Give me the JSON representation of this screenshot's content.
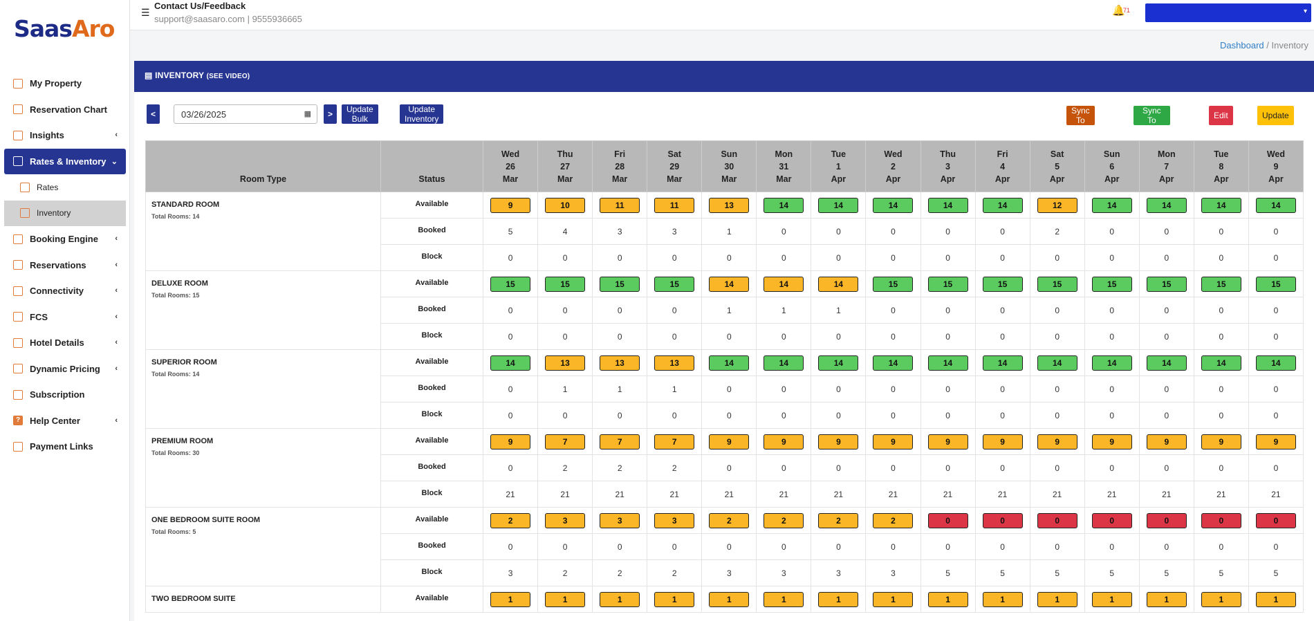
{
  "brand": {
    "part1": "Saas",
    "part2": "Aro"
  },
  "topbar": {
    "contact_title": "Contact Us/Feedback",
    "contact_info": "support@saasaro.com | 9555936665",
    "notification_count": "71"
  },
  "breadcrumb": {
    "home": "Dashboard",
    "separator": "/",
    "current": "Inventory"
  },
  "sidebar": {
    "items": [
      {
        "label": "My Property",
        "icon": "home-icon",
        "chevron": false
      },
      {
        "label": "Reservation Chart",
        "icon": "calendar-icon",
        "chevron": false
      },
      {
        "label": "Insights",
        "icon": "chart-pie-icon",
        "chevron": true
      },
      {
        "label": "Rates & Inventory",
        "icon": "building-icon",
        "chevron": true,
        "active": true
      },
      {
        "label": "Rates",
        "icon": "rates-icon",
        "sub": true
      },
      {
        "label": "Inventory",
        "icon": "inventory-icon",
        "sub": true,
        "selected": true
      },
      {
        "label": "Booking Engine",
        "icon": "booking-engine-icon",
        "chevron": true
      },
      {
        "label": "Reservations",
        "icon": "reservations-icon",
        "chevron": true
      },
      {
        "label": "Connectivity",
        "icon": "connectivity-icon",
        "chevron": true
      },
      {
        "label": "FCS",
        "icon": "id-card-icon",
        "chevron": true
      },
      {
        "label": "Hotel Details",
        "icon": "hotel-icon",
        "chevron": true
      },
      {
        "label": "Dynamic Pricing",
        "icon": "dynamic-pricing-icon",
        "chevron": true
      },
      {
        "label": "Subscription",
        "icon": "dollar-icon",
        "chevron": false
      },
      {
        "label": "Help Center",
        "icon": "help-icon",
        "chevron": true
      },
      {
        "label": "Payment Links",
        "icon": "payment-link-icon",
        "chevron": false
      }
    ]
  },
  "panel": {
    "title": "INVENTORY",
    "see_video": "(SEE VIDEO)"
  },
  "toolbar": {
    "prev_label": "<",
    "next_label": ">",
    "date_value": "03/26/2025",
    "update_bulk": "Update Bulk",
    "update_team": "Update Inventory (Team)",
    "sync_ota": "Sync To OTA",
    "sync_google": "Sync To Google",
    "edit": "Edit",
    "update": "Update"
  },
  "table": {
    "headers": {
      "room_type": "Room Type",
      "status": "Status"
    },
    "days": [
      {
        "dow": "Wed",
        "day": "26",
        "mon": "Mar"
      },
      {
        "dow": "Thu",
        "day": "27",
        "mon": "Mar"
      },
      {
        "dow": "Fri",
        "day": "28",
        "mon": "Mar"
      },
      {
        "dow": "Sat",
        "day": "29",
        "mon": "Mar"
      },
      {
        "dow": "Sun",
        "day": "30",
        "mon": "Mar"
      },
      {
        "dow": "Mon",
        "day": "31",
        "mon": "Mar"
      },
      {
        "dow": "Tue",
        "day": "1",
        "mon": "Apr"
      },
      {
        "dow": "Wed",
        "day": "2",
        "mon": "Apr"
      },
      {
        "dow": "Thu",
        "day": "3",
        "mon": "Apr"
      },
      {
        "dow": "Fri",
        "day": "4",
        "mon": "Apr"
      },
      {
        "dow": "Sat",
        "day": "5",
        "mon": "Apr"
      },
      {
        "dow": "Sun",
        "day": "6",
        "mon": "Apr"
      },
      {
        "dow": "Mon",
        "day": "7",
        "mon": "Apr"
      },
      {
        "dow": "Tue",
        "day": "8",
        "mon": "Apr"
      },
      {
        "dow": "Wed",
        "day": "9",
        "mon": "Apr"
      }
    ],
    "status_labels": {
      "available": "Available",
      "booked": "Booked",
      "block": "Block"
    },
    "status_colors": {
      "g": "#5ccb5f",
      "o": "#fbb627",
      "r": "#dc3545"
    },
    "rooms": [
      {
        "name": "STANDARD ROOM",
        "total": "Total Rooms: 14",
        "available": [
          "9",
          "10",
          "11",
          "11",
          "13",
          "14",
          "14",
          "14",
          "14",
          "14",
          "12",
          "14",
          "14",
          "14",
          "14"
        ],
        "avail_status": [
          "o",
          "o",
          "o",
          "o",
          "o",
          "g",
          "g",
          "g",
          "g",
          "g",
          "o",
          "g",
          "g",
          "g",
          "g"
        ],
        "booked": [
          "5",
          "4",
          "3",
          "3",
          "1",
          "0",
          "0",
          "0",
          "0",
          "0",
          "2",
          "0",
          "0",
          "0",
          "0"
        ],
        "block": [
          "0",
          "0",
          "0",
          "0",
          "0",
          "0",
          "0",
          "0",
          "0",
          "0",
          "0",
          "0",
          "0",
          "0",
          "0"
        ]
      },
      {
        "name": "DELUXE ROOM",
        "total": "Total Rooms: 15",
        "available": [
          "15",
          "15",
          "15",
          "15",
          "14",
          "14",
          "14",
          "15",
          "15",
          "15",
          "15",
          "15",
          "15",
          "15",
          "15"
        ],
        "avail_status": [
          "g",
          "g",
          "g",
          "g",
          "o",
          "o",
          "o",
          "g",
          "g",
          "g",
          "g",
          "g",
          "g",
          "g",
          "g"
        ],
        "booked": [
          "0",
          "0",
          "0",
          "0",
          "1",
          "1",
          "1",
          "0",
          "0",
          "0",
          "0",
          "0",
          "0",
          "0",
          "0"
        ],
        "block": [
          "0",
          "0",
          "0",
          "0",
          "0",
          "0",
          "0",
          "0",
          "0",
          "0",
          "0",
          "0",
          "0",
          "0",
          "0"
        ]
      },
      {
        "name": "SUPERIOR ROOM",
        "total": "Total Rooms: 14",
        "available": [
          "14",
          "13",
          "13",
          "13",
          "14",
          "14",
          "14",
          "14",
          "14",
          "14",
          "14",
          "14",
          "14",
          "14",
          "14"
        ],
        "avail_status": [
          "g",
          "o",
          "o",
          "o",
          "g",
          "g",
          "g",
          "g",
          "g",
          "g",
          "g",
          "g",
          "g",
          "g",
          "g"
        ],
        "booked": [
          "0",
          "1",
          "1",
          "1",
          "0",
          "0",
          "0",
          "0",
          "0",
          "0",
          "0",
          "0",
          "0",
          "0",
          "0"
        ],
        "block": [
          "0",
          "0",
          "0",
          "0",
          "0",
          "0",
          "0",
          "0",
          "0",
          "0",
          "0",
          "0",
          "0",
          "0",
          "0"
        ]
      },
      {
        "name": "PREMIUM ROOM",
        "total": "Total Rooms: 30",
        "available": [
          "9",
          "7",
          "7",
          "7",
          "9",
          "9",
          "9",
          "9",
          "9",
          "9",
          "9",
          "9",
          "9",
          "9",
          "9"
        ],
        "avail_status": [
          "o",
          "o",
          "o",
          "o",
          "o",
          "o",
          "o",
          "o",
          "o",
          "o",
          "o",
          "o",
          "o",
          "o",
          "o"
        ],
        "booked": [
          "0",
          "2",
          "2",
          "2",
          "0",
          "0",
          "0",
          "0",
          "0",
          "0",
          "0",
          "0",
          "0",
          "0",
          "0"
        ],
        "block": [
          "21",
          "21",
          "21",
          "21",
          "21",
          "21",
          "21",
          "21",
          "21",
          "21",
          "21",
          "21",
          "21",
          "21",
          "21"
        ]
      },
      {
        "name": "ONE BEDROOM SUITE ROOM",
        "total": "Total Rooms: 5",
        "available": [
          "2",
          "3",
          "3",
          "3",
          "2",
          "2",
          "2",
          "2",
          "0",
          "0",
          "0",
          "0",
          "0",
          "0",
          "0"
        ],
        "avail_status": [
          "o",
          "o",
          "o",
          "o",
          "o",
          "o",
          "o",
          "o",
          "r",
          "r",
          "r",
          "r",
          "r",
          "r",
          "r"
        ],
        "booked": [
          "0",
          "0",
          "0",
          "0",
          "0",
          "0",
          "0",
          "0",
          "0",
          "0",
          "0",
          "0",
          "0",
          "0",
          "0"
        ],
        "block": [
          "3",
          "2",
          "2",
          "2",
          "3",
          "3",
          "3",
          "3",
          "5",
          "5",
          "5",
          "5",
          "5",
          "5",
          "5"
        ]
      },
      {
        "name": "TWO BEDROOM SUITE",
        "total": "",
        "available": [
          "1",
          "1",
          "1",
          "1",
          "1",
          "1",
          "1",
          "1",
          "1",
          "1",
          "1",
          "1",
          "1",
          "1",
          "1"
        ],
        "avail_status": [
          "o",
          "o",
          "o",
          "o",
          "o",
          "o",
          "o",
          "o",
          "o",
          "o",
          "o",
          "o",
          "o",
          "o",
          "o"
        ],
        "booked": [],
        "block": []
      }
    ]
  }
}
